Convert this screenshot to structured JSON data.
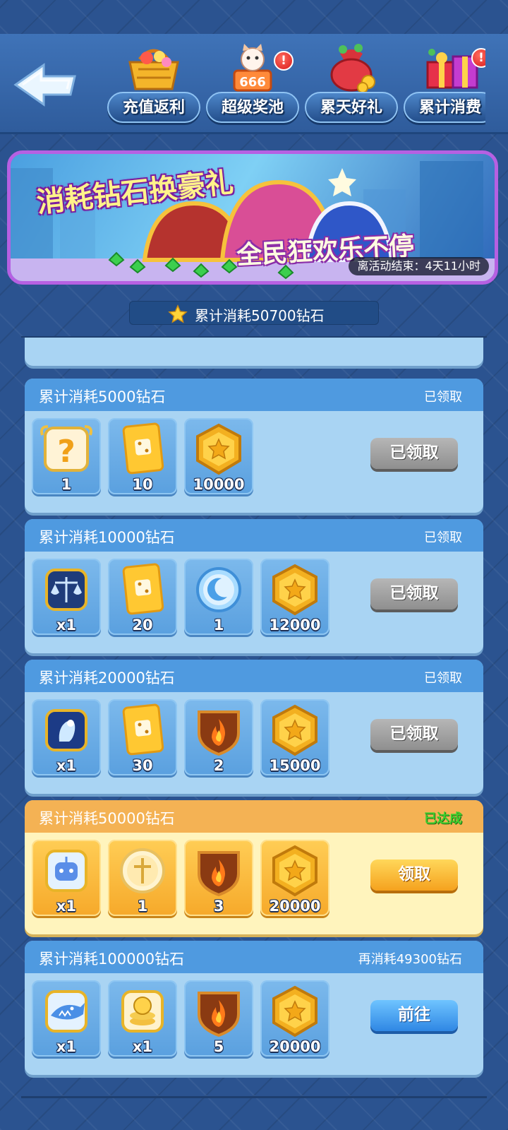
{
  "topbar": {
    "back": "back-arrow-icon",
    "tabs": [
      {
        "label": "充值返利",
        "icon": "shopping-basket-icon",
        "badge": ""
      },
      {
        "label": "超级奖池",
        "icon": "lucky-cat-icon",
        "badge": "!"
      },
      {
        "label": "累天好礼",
        "icon": "money-bag-icon",
        "badge": ""
      },
      {
        "label": "累计消费",
        "icon": "gift-box-icon",
        "badge": "!"
      }
    ]
  },
  "banner": {
    "title": "消耗钻石换豪礼",
    "subtitle": "全民狂欢乐不停",
    "timer": "离活动结束：4天11小时"
  },
  "total": {
    "text": "累计消耗50700钻石",
    "icon": "star-icon"
  },
  "tiers": [
    {
      "title": "累计消耗5000钻石",
      "status": "已领取",
      "button": "已领取",
      "button_style": "gray",
      "rewards": [
        {
          "icon": "mystery-box-icon",
          "qty": "1"
        },
        {
          "icon": "dice-card-icon",
          "qty": "10"
        },
        {
          "icon": "gold-coin-icon",
          "qty": "10000"
        }
      ]
    },
    {
      "title": "累计消耗10000钻石",
      "status": "已领取",
      "button": "已领取",
      "button_style": "gray",
      "rewards": [
        {
          "icon": "scales-badge-icon",
          "qty": "x1"
        },
        {
          "icon": "dice-card-icon",
          "qty": "20"
        },
        {
          "icon": "moon-orb-icon",
          "qty": "1"
        },
        {
          "icon": "gold-coin-icon",
          "qty": "12000"
        }
      ]
    },
    {
      "title": "累计消耗20000钻石",
      "status": "已领取",
      "button": "已领取",
      "button_style": "gray",
      "rewards": [
        {
          "icon": "spirit-badge-icon",
          "qty": "x1"
        },
        {
          "icon": "dice-card-icon",
          "qty": "30"
        },
        {
          "icon": "flame-shield-icon",
          "qty": "2"
        },
        {
          "icon": "gold-coin-icon",
          "qty": "15000"
        }
      ]
    },
    {
      "title": "累计消耗50000钻石",
      "status": "已达成",
      "button": "领取",
      "button_style": "orange",
      "rewards": [
        {
          "icon": "robot-badge-icon",
          "qty": "x1"
        },
        {
          "icon": "cross-coin-icon",
          "qty": "1"
        },
        {
          "icon": "flame-shield-icon",
          "qty": "3"
        },
        {
          "icon": "gold-coin-icon",
          "qty": "20000"
        }
      ]
    },
    {
      "title": "累计消耗100000钻石",
      "status": "再消耗49300钻石",
      "button": "前往",
      "button_style": "blue",
      "rewards": [
        {
          "icon": "shark-badge-icon",
          "qty": "x1"
        },
        {
          "icon": "coin-stack-badge-icon",
          "qty": "x1"
        },
        {
          "icon": "flame-shield-icon",
          "qty": "5"
        },
        {
          "icon": "gold-coin-icon",
          "qty": "20000"
        }
      ]
    }
  ]
}
